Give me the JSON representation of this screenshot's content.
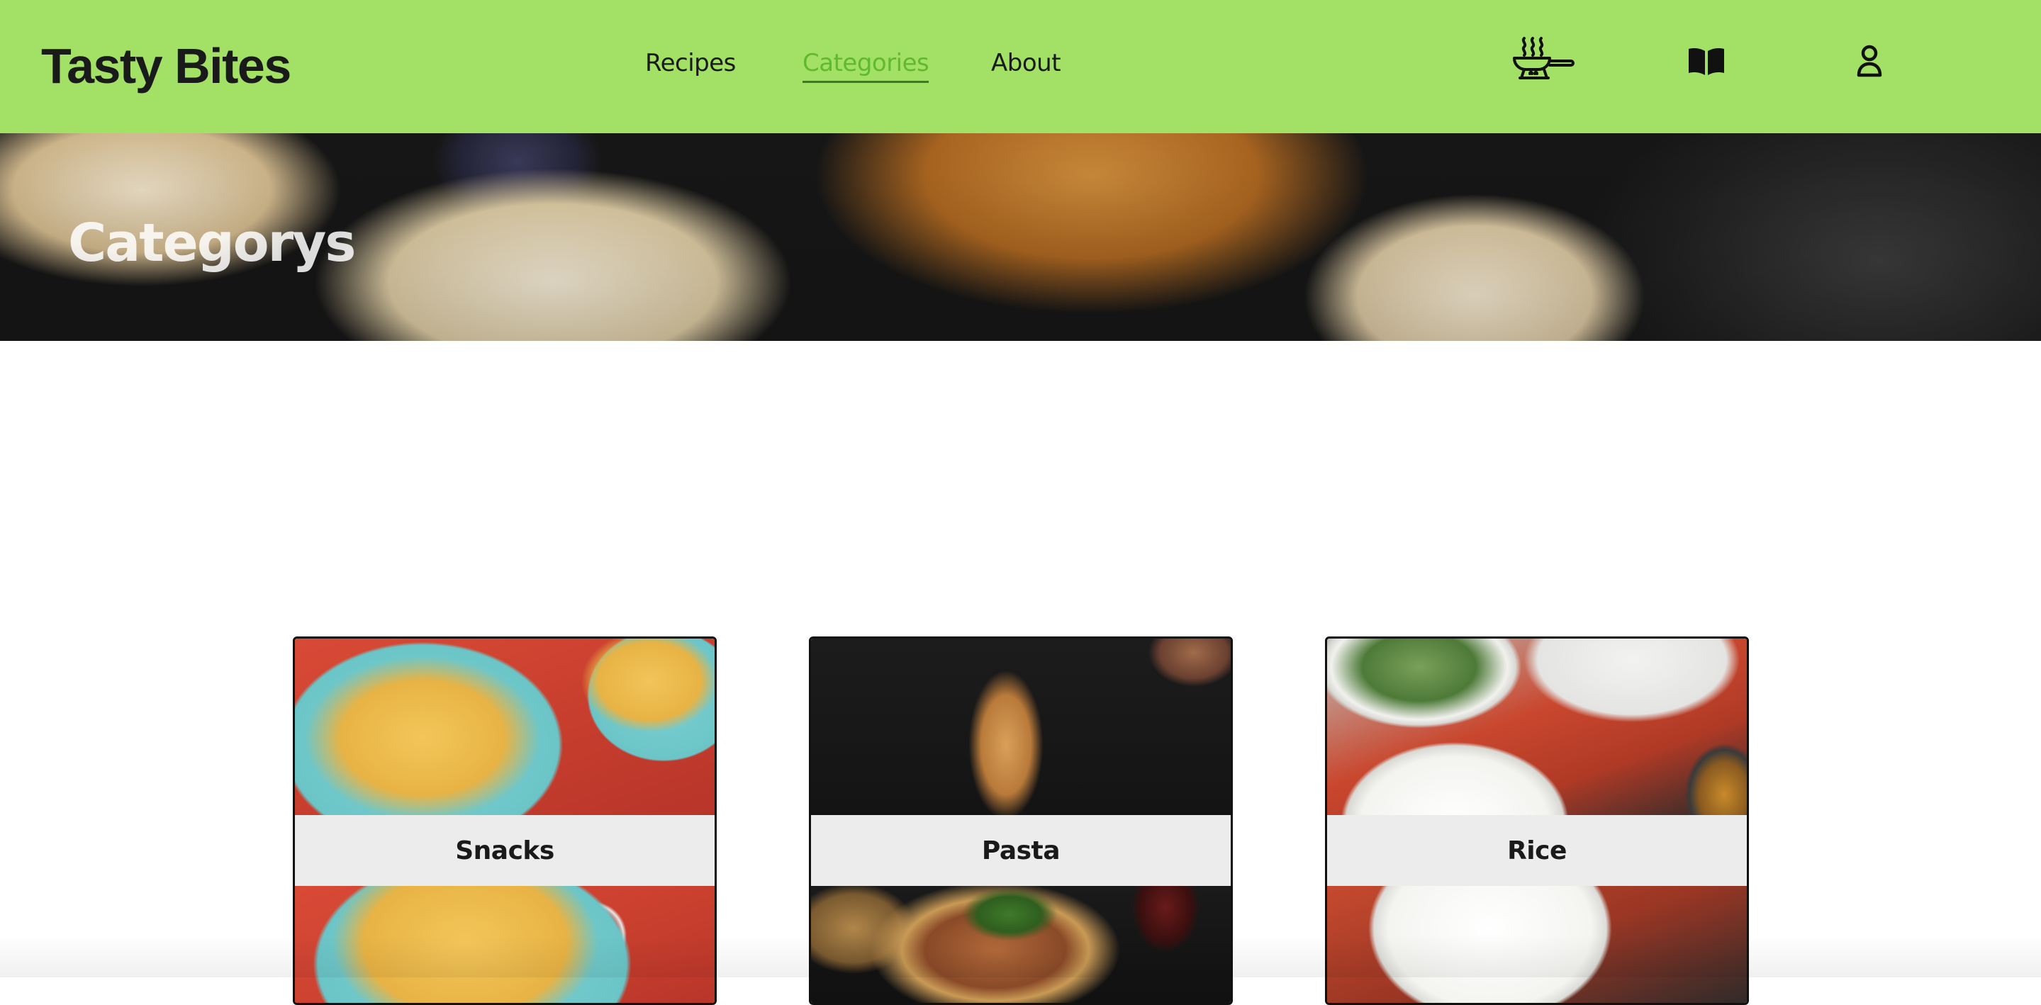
{
  "header": {
    "brand": "Tasty Bites",
    "nav": [
      {
        "label": "Recipes",
        "active": false
      },
      {
        "label": "Categories",
        "active": true
      },
      {
        "label": "About",
        "active": false
      }
    ],
    "icons": [
      "cooking-pan-icon",
      "book-icon",
      "user-icon"
    ]
  },
  "hero": {
    "title": "Categorys"
  },
  "categories": [
    {
      "label": "Snacks"
    },
    {
      "label": "Pasta"
    },
    {
      "label": "Rice"
    }
  ],
  "colors": {
    "header_bg": "#a3e066",
    "active_link": "#5fba2f",
    "text_dark": "#1a1a1a",
    "card_label_band": "#ececec"
  }
}
